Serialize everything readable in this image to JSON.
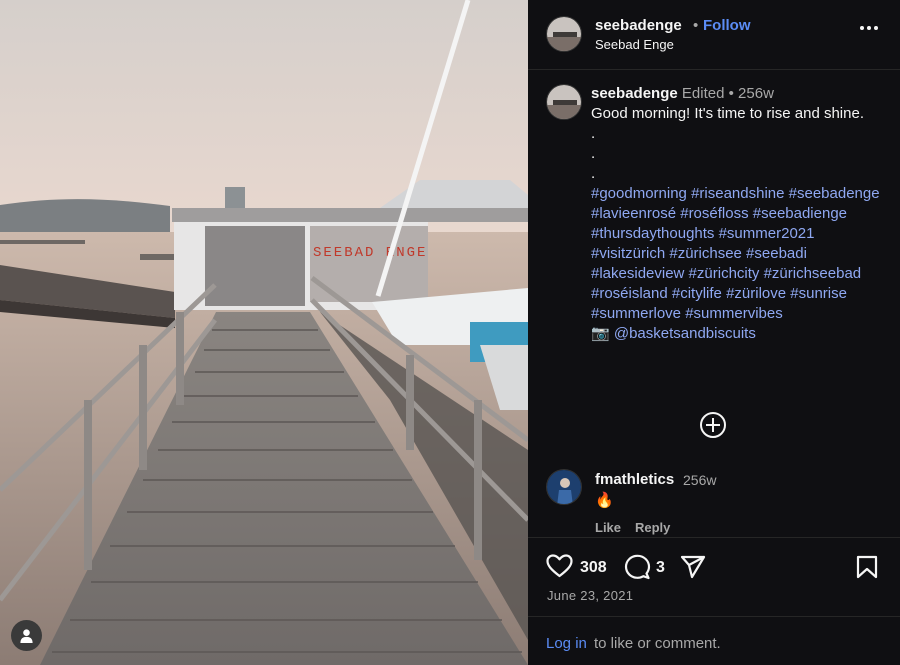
{
  "photo": {
    "sign_text": "SEEBAD ENGE",
    "user_tag_icon": "person-icon"
  },
  "header": {
    "username": "seebadenge",
    "separator": "•",
    "follow_label": "Follow",
    "location": "Seebad Enge",
    "more_icon": "more-horizontal-icon"
  },
  "caption": {
    "username": "seebadenge",
    "edited": "Edited",
    "separator": "•",
    "age": "256w",
    "text": "Good morning! It's time to rise and shine.",
    "dots": [
      ".",
      ".",
      "."
    ],
    "hashtags": "#goodmorning #riseandshine #seebadenge #lavieenrosé #roséfloss #seebadienge #thursdaythoughts #summer2021 #visitzürich #zürichsee #seebadi #lakesideview #zürichcity #zürichseebad #roséisland #citylife #zürilove #sunrise #summerlove #summervibes",
    "camera_emoji": "📷",
    "mention": "@basketsandbiscuits",
    "load_more_icon": "plus-circle-icon"
  },
  "comment": {
    "username": "fmathletics",
    "age": "256w",
    "text": "🔥",
    "like_label": "Like",
    "reply_label": "Reply"
  },
  "actions": {
    "likes": "308",
    "comments": "3",
    "date": "June 23, 2021"
  },
  "login": {
    "link": "Log in",
    "rest": "to like or comment."
  },
  "colors": {
    "background": "#0f0f12",
    "link_blue": "#5b8cf5",
    "hashtag_blue": "#8fa8f2",
    "muted": "#a8a8a8"
  }
}
